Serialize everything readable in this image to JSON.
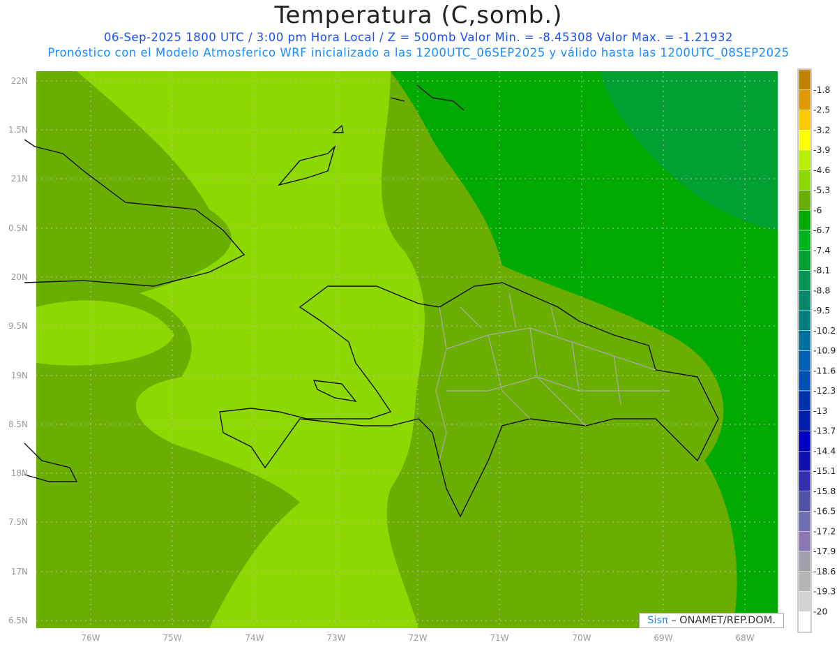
{
  "header": {
    "title": "Temperatura (C,somb.)",
    "subtitle1": "06-Sep-2025  1800 UTC / 3:00 pm Hora Local / Z = 500mb  Valor Min. = -8.45308  Valor Max. = -1.21932",
    "subtitle2": "Pronóstico con el Modelo Atmosferico WRF inicializado a las 1200UTC_06SEP2025 y válido hasta las  1200UTC_08SEP2025"
  },
  "axes": {
    "lat_labels": [
      "22N",
      "1.5N",
      "21N",
      "0.5N",
      "20N",
      "9.5N",
      "19N",
      "8.5N",
      "18N",
      "7.5N",
      "17N",
      "6.5N"
    ],
    "lon_labels": [
      "76W",
      "75W",
      "74W",
      "73W",
      "72W",
      "71W",
      "70W",
      "69W",
      "68W"
    ]
  },
  "colorbar": {
    "labels": [
      "-1.8",
      "-2.5",
      "-3.2",
      "-3.9",
      "-4.6",
      "-5.3",
      "-6",
      "-6.7",
      "-7.4",
      "-8.1",
      "-8.8",
      "-9.5",
      "-10.2",
      "-10.9",
      "-11.6",
      "-12.3",
      "-13",
      "-13.7",
      "-14.4",
      "-15.1",
      "-15.8",
      "-16.5",
      "-17.2",
      "-17.9",
      "-18.6",
      "-19.3",
      "-20"
    ],
    "colors": [
      "#c08000",
      "#e09a00",
      "#ffc800",
      "#ffff00",
      "#b4f000",
      "#8cd800",
      "#6aae00",
      "#00aa00",
      "#00b41e",
      "#00a032",
      "#009650",
      "#00876e",
      "#007f82",
      "#00709c",
      "#0060b4",
      "#0050b4",
      "#0032aa",
      "#001eaa",
      "#0000c0",
      "#1010b0",
      "#3030b0",
      "#5050a8",
      "#7070b0",
      "#8c78b4",
      "#a0a0aa",
      "#b4b4b4",
      "#d2d2d2",
      "#ffffff"
    ]
  },
  "logo": {
    "brand": "Sisπ",
    "text": " – ONAMET/REP.DOM."
  }
}
